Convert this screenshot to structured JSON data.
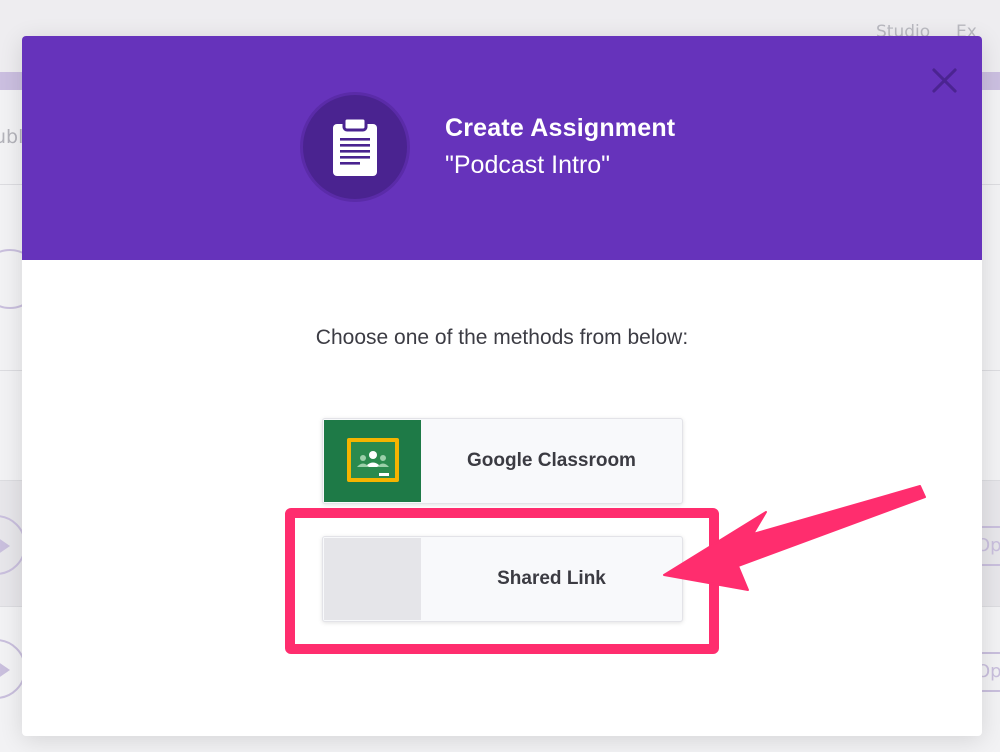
{
  "background": {
    "nav_items": [
      "Studio",
      "Ex"
    ],
    "tab_fragment": "ubl",
    "open_buttons": [
      "Op",
      "Op"
    ]
  },
  "modal": {
    "title": "Create Assignment",
    "subtitle": "\"Podcast Intro\"",
    "icon": "clipboard-icon",
    "close_icon": "close-icon",
    "prompt": "Choose one of the methods from below:",
    "options": [
      {
        "label": "Google Classroom",
        "icon": "google-classroom-icon"
      },
      {
        "label": "Shared Link",
        "icon": "blank-thumbnail"
      }
    ]
  },
  "colors": {
    "header_purple": "#6633bb",
    "icon_circle": "#4a2390",
    "classroom_green": "#1e7a47",
    "annotation_pink": "#ff2d6e"
  }
}
